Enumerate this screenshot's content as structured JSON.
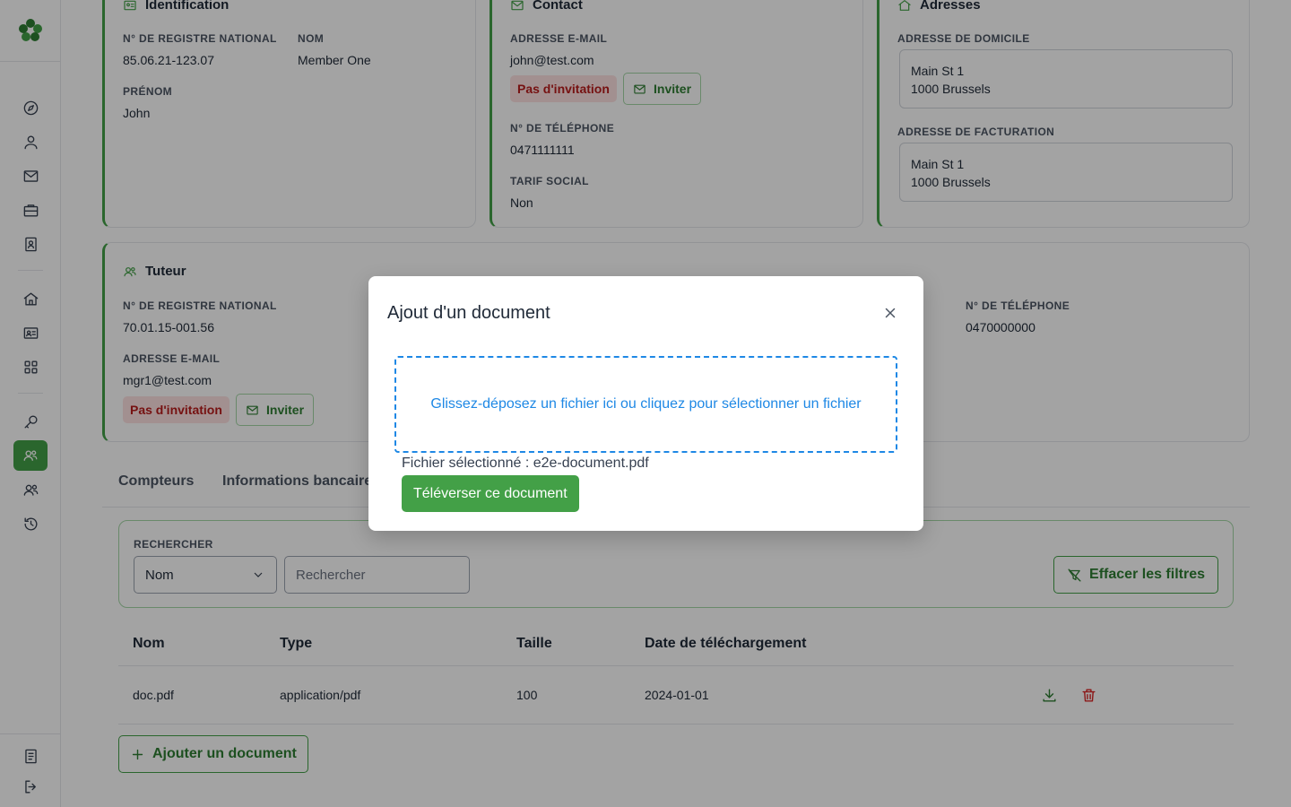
{
  "colors": {
    "accent": "#43a047",
    "danger": "#b91c1c",
    "link": "#1e88e5"
  },
  "sidebar": {
    "icons": [
      "compass-icon",
      "user-icon",
      "mail-icon",
      "briefcase-icon",
      "contact-book-icon",
      "home-icon",
      "id-card-icon",
      "grid-icon",
      "key-icon",
      "users-active-icon",
      "users-icon",
      "history-icon",
      "document-icon",
      "logout-icon"
    ]
  },
  "identification": {
    "title": "Identification",
    "national_register_label": "N° DE REGISTRE NATIONAL",
    "national_register_value": "85.06.21-123.07",
    "name_label": "NOM",
    "name_value": "Member One",
    "first_name_label": "PRÉNOM",
    "first_name_value": "John"
  },
  "contact": {
    "title": "Contact",
    "email_label": "ADRESSE E-MAIL",
    "email_value": "john@test.com",
    "badge": "Pas d'invitation",
    "invite_label": "Inviter",
    "phone_label": "N° DE TÉLÉPHONE",
    "phone_value": "0471111111",
    "social_rate_label": "TARIF SOCIAL",
    "social_rate_value": "Non"
  },
  "addresses": {
    "title": "Adresses",
    "home_label": "ADRESSE DE DOMICILE",
    "home_line1": "Main St 1",
    "home_line2": "1000 Brussels",
    "billing_label": "ADRESSE DE FACTURATION",
    "billing_line1": "Main St 1",
    "billing_line2": "1000 Brussels"
  },
  "guardian": {
    "title": "Tuteur",
    "national_register_label": "N° DE REGISTRE NATIONAL",
    "national_register_value": "70.01.15-001.56",
    "email_label": "ADRESSE E-MAIL",
    "email_value": "mgr1@test.com",
    "badge": "Pas d'invitation",
    "invite_label": "Inviter",
    "phone_label": "N° DE TÉLÉPHONE",
    "phone_value": "0470000000"
  },
  "tabs": [
    "Compteurs",
    "Informations bancaires"
  ],
  "filters": {
    "label": "RECHERCHER",
    "select_value": "Nom",
    "search_placeholder": "Rechercher",
    "clear_label": "Effacer les filtres"
  },
  "table": {
    "columns": [
      "Nom",
      "Type",
      "Taille",
      "Date de téléchargement"
    ],
    "rows": [
      {
        "name": "doc.pdf",
        "type": "application/pdf",
        "size": "100",
        "date": "2024-01-01"
      }
    ]
  },
  "add_document_label": "Ajouter un document",
  "modal": {
    "title": "Ajout d'un document",
    "dropzone_text": "Glissez-déposez un fichier ici ou cliquez pour sélectionner un fichier",
    "selected_file": "Fichier sélectionné : e2e-document.pdf",
    "upload_label": "Téléverser ce document"
  }
}
